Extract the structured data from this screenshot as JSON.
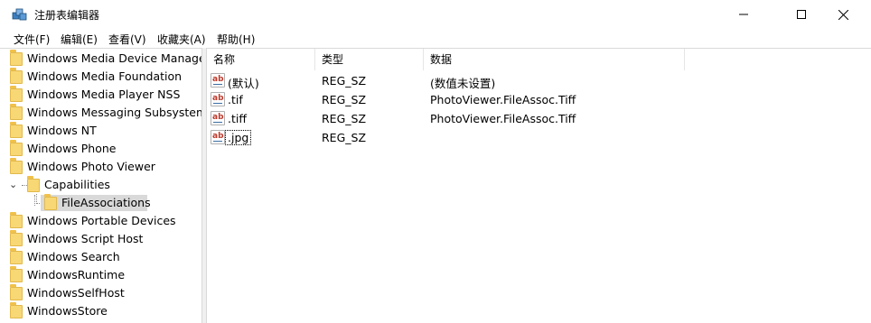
{
  "window": {
    "title": "注册表编辑器",
    "icon": "regedit-icon",
    "controls": {
      "minimize": "—",
      "maximize": "☐",
      "close": "✕"
    }
  },
  "menu": [
    "文件(F)",
    "编辑(E)",
    "查看(V)",
    "收藏夹(A)",
    "帮助(H)"
  ],
  "tree": {
    "items": [
      {
        "label": "Windows Media Device Manager",
        "level": 0
      },
      {
        "label": "Windows Media Foundation",
        "level": 0
      },
      {
        "label": "Windows Media Player NSS",
        "level": 0
      },
      {
        "label": "Windows Messaging Subsystem",
        "level": 0
      },
      {
        "label": "Windows NT",
        "level": 0
      },
      {
        "label": "Windows Phone",
        "level": 0
      },
      {
        "label": "Windows Photo Viewer",
        "level": 0
      },
      {
        "label": "Capabilities",
        "level": 1,
        "expanded": true
      },
      {
        "label": "FileAssociations",
        "level": 2,
        "selected": true
      },
      {
        "label": "Windows Portable Devices",
        "level": 0
      },
      {
        "label": "Windows Script Host",
        "level": 0
      },
      {
        "label": "Windows Search",
        "level": 0
      },
      {
        "label": "WindowsRuntime",
        "level": 0
      },
      {
        "label": "WindowsSelfHost",
        "level": 0
      },
      {
        "label": "WindowsStore",
        "level": 0
      }
    ],
    "expander_glyph": "⌄"
  },
  "list": {
    "headers": {
      "name": "名称",
      "type": "类型",
      "data": "数据"
    },
    "rows": [
      {
        "icon": "string-value-icon",
        "name": "(默认)",
        "type": "REG_SZ",
        "data": "(数值未设置)"
      },
      {
        "icon": "string-value-icon",
        "name": ".tif",
        "type": "REG_SZ",
        "data": "PhotoViewer.FileAssoc.Tiff"
      },
      {
        "icon": "string-value-icon",
        "name": ".tiff",
        "type": "REG_SZ",
        "data": "PhotoViewer.FileAssoc.Tiff"
      },
      {
        "icon": "string-value-icon",
        "name": ".jpg",
        "type": "REG_SZ",
        "data": "",
        "editing": true
      }
    ],
    "icon_glyph": "ab"
  }
}
